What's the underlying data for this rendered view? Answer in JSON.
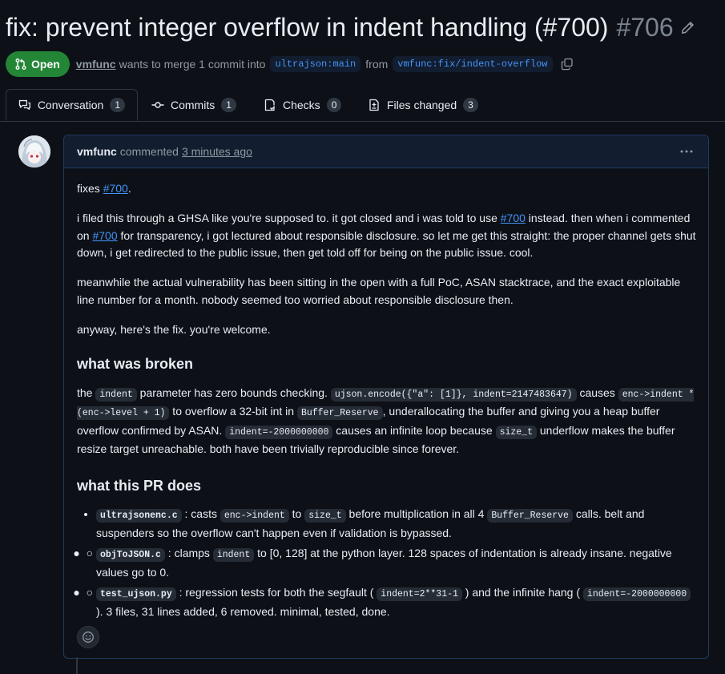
{
  "pr": {
    "title": "fix: prevent integer overflow in indent handling (#700)",
    "number": "#706",
    "state": "Open",
    "author": "vmfunc",
    "merge_text": "wants to merge 1 commit into",
    "base_branch": "ultrajson:main",
    "from_text": "from",
    "head_branch": "vmfunc:fix/indent-overflow"
  },
  "tabs": [
    {
      "label": "Conversation",
      "count": "1",
      "icon": "comment-discussion-icon"
    },
    {
      "label": "Commits",
      "count": "1",
      "icon": "git-commit-icon"
    },
    {
      "label": "Checks",
      "count": "0",
      "icon": "checklist-icon"
    },
    {
      "label": "Files changed",
      "count": "3",
      "icon": "file-diff-icon"
    }
  ],
  "comment": {
    "author": "vmfunc",
    "action": "commented",
    "time": "3 minutes ago",
    "p1_pre": "fixes ",
    "p1_ref": "#700",
    "p1_post": ".",
    "p2_a": "i filed this through a GHSA like you're supposed to. it got closed and i was told to use ",
    "p2_ref1": "#700",
    "p2_b": " instead. then when i commented on ",
    "p2_ref2": "#700",
    "p2_c": " for transparency, i got lectured about responsible disclosure. so let me get this straight: the proper channel gets shut down, i get redirected to the public issue, then get told off for being on the public issue. cool.",
    "p3": "meanwhile the actual vulnerability has been sitting in the open with a full PoC, ASAN stacktrace, and the exact exploitable line number for a month. nobody seemed too worried about responsible disclosure then.",
    "p4": "anyway, here's the fix. you're welcome.",
    "h1": "what was broken",
    "b_1": "the ",
    "b_code1": "indent",
    "b_2": " parameter has zero bounds checking. ",
    "b_code2": "ujson.encode({\"a\": [1]}, indent=2147483647)",
    "b_3": " causes ",
    "b_code3": "enc->indent * (enc->level + 1)",
    "b_4": " to overflow a 32-bit int in ",
    "b_code4": "Buffer_Reserve",
    "b_5": ", underallocating the buffer and giving you a heap buffer overflow confirmed by ASAN. ",
    "b_code5": "indent=-2000000000",
    "b_6": " causes an infinite loop because ",
    "b_code6": "size_t",
    "b_7": " underflow makes the buffer resize target unreachable. both have been trivially reproducible since forever.",
    "h2": "what this PR does",
    "li1_file": "ultrajsonenc.c",
    "li1_a": " : casts ",
    "li1_code1": "enc->indent",
    "li1_b": " to ",
    "li1_code2": "size_t",
    "li1_c": " before multiplication in all 4 ",
    "li1_code3": "Buffer_Reserve",
    "li1_d": " calls. belt and suspenders so the overflow can't happen even if validation is bypassed.",
    "li2_file": "objToJSON.c",
    "li2_a": " : clamps ",
    "li2_code1": "indent",
    "li2_b": " to [0, 128] at the python layer. 128 spaces of indentation is already insane. negative values go to 0.",
    "li3_file": "test_ujson.py",
    "li3_a": " : regression tests for both the segfault ( ",
    "li3_code1": "indent=2**31-1",
    "li3_b": " ) and the infinite hang ( ",
    "li3_code2": "indent=-2000000000",
    "li3_c": " ). 3 files, 31 lines added, 6 removed. minimal, tested, done."
  },
  "colors": {
    "accent": "#4493f8",
    "open": "#238636",
    "bg": "#0d1117"
  }
}
